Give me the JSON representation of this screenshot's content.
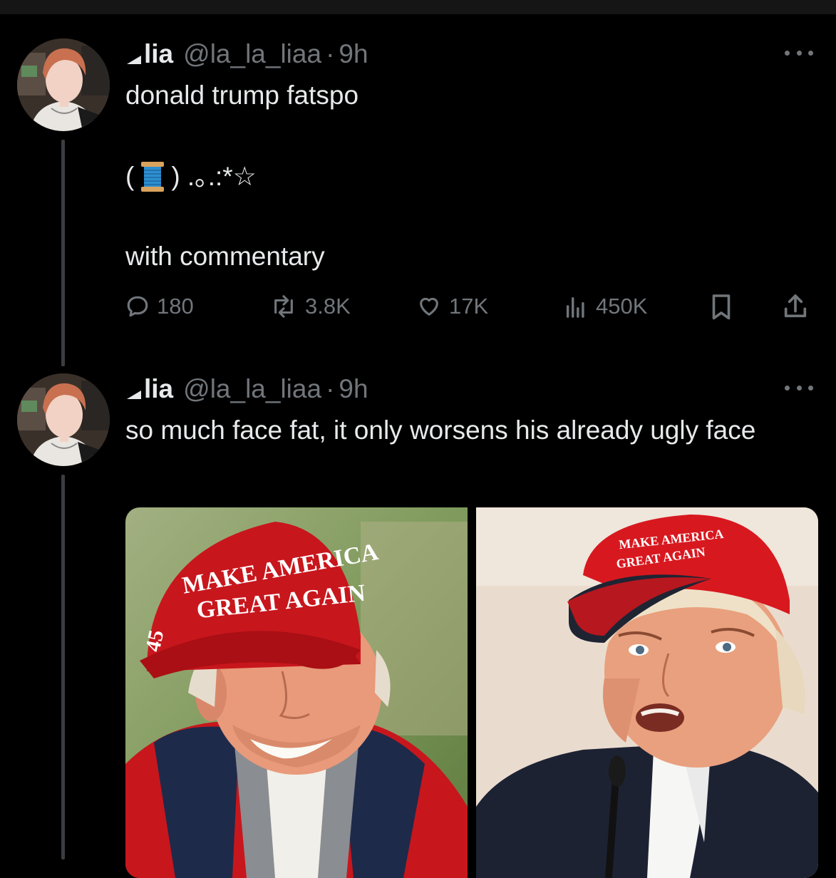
{
  "posts": [
    {
      "author": {
        "name": "lia",
        "handle": "@la_la_liaa",
        "dot": "·",
        "time": "9h"
      },
      "lines": [
        "donald trump fatspo",
        "( ",
        " )  .｡.:*☆",
        "with commentary"
      ],
      "actions": {
        "replies": "180",
        "reposts": "3.8K",
        "likes": "17K",
        "views": "450K"
      }
    },
    {
      "author": {
        "name": "lia",
        "handle": "@la_la_liaa",
        "dot": "·",
        "time": "9h"
      },
      "text": "so much face fat, it only worsens his already ugly face",
      "media": [
        {
          "hat_line1": "MAKE AMERICA",
          "hat_line2": "GREAT AGAIN",
          "side_number": "45"
        },
        {
          "hat_line1": "MAKE AMERICA",
          "hat_line2": "GREAT AGAIN"
        }
      ]
    }
  ],
  "colors": {
    "background": "#000000",
    "text": "#e7e9ea",
    "muted": "#71767b",
    "thread": "#3a3d41",
    "hat_red": "#c8161d"
  }
}
